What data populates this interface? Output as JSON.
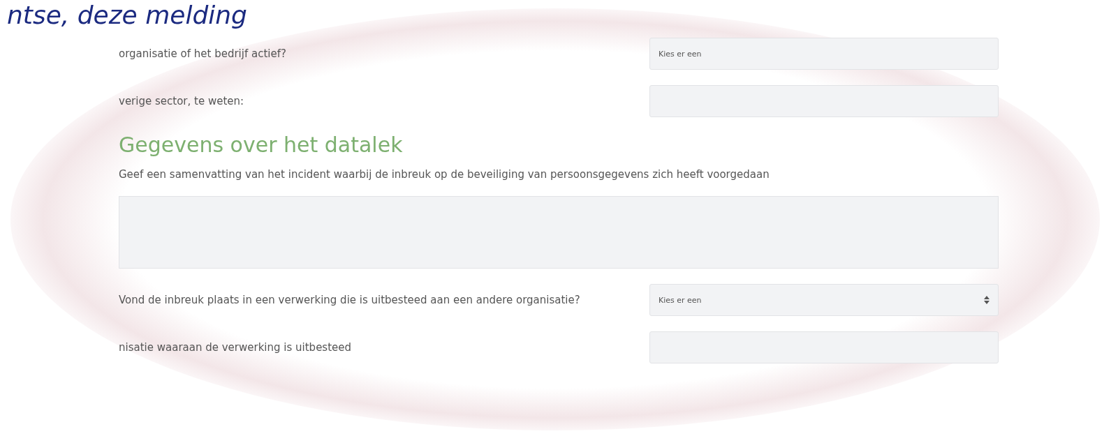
{
  "slide_title": "ntse, deze melding",
  "fields_top": [
    {
      "kind": "select",
      "label": "organisatie of het bedrijf actief?",
      "value": "Kies er een"
    },
    {
      "kind": "input",
      "label": "verige sector, te weten:"
    }
  ],
  "section": {
    "heading": "Gegevens over het datalek",
    "summary_label": "Geef een samenvatting van het incident waarbij de inbreuk op de beveiliging van persoonsgegevens zich heeft voorgedaan"
  },
  "fields_bottom": [
    {
      "kind": "select",
      "label": "Vond de inbreuk plaats in een verwerking die is uitbesteed aan een andere organisatie?",
      "value": "Kies er een"
    },
    {
      "kind": "input",
      "label": "nisatie waaraan de verwerking is uitbesteed"
    }
  ]
}
